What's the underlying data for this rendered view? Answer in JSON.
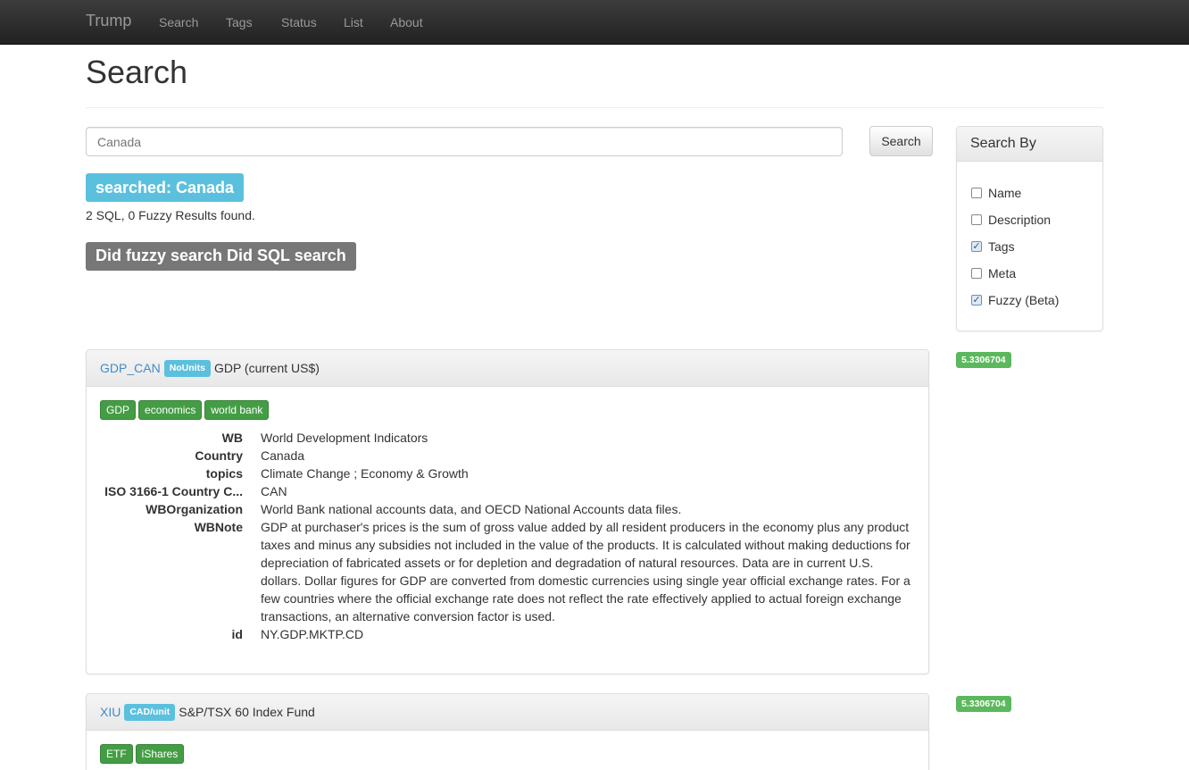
{
  "navbar": {
    "brand": "Trump",
    "items": [
      "Search",
      "Tags",
      "Status",
      "List",
      "About"
    ]
  },
  "page_title": "Search",
  "search": {
    "placeholder": "Canada",
    "button_label": "Search"
  },
  "searched_label": "searched: Canada",
  "results_count": "2 SQL, 0 Fuzzy Results found.",
  "did_label": "Did fuzzy search Did SQL search",
  "sidebar": {
    "heading": "Search By",
    "options": [
      {
        "label": "Name",
        "checked": false
      },
      {
        "label": "Description",
        "checked": false
      },
      {
        "label": "Tags",
        "checked": true
      },
      {
        "label": "Meta",
        "checked": false
      },
      {
        "label": "Fuzzy (Beta)",
        "checked": true
      }
    ]
  },
  "results": [
    {
      "name": "GDP_CAN",
      "unit": "NoUnits",
      "title": "GDP (current US$)",
      "score": "5.3306704",
      "tags": [
        "GDP",
        "economics",
        "world bank"
      ],
      "meta": [
        {
          "key": "WB",
          "value": "World Development Indicators"
        },
        {
          "key": "Country",
          "value": "Canada"
        },
        {
          "key": "topics",
          "value": "Climate Change ; Economy & Growth"
        },
        {
          "key": "ISO 3166-1 Country C...",
          "value": "CAN"
        },
        {
          "key": "WBOrganization",
          "value": "World Bank national accounts data, and OECD National Accounts data files."
        },
        {
          "key": "WBNote",
          "value": "GDP at purchaser's prices is the sum of gross value added by all resident producers in the economy plus any product taxes and minus any subsidies not included in the value of the products. It is calculated without making deductions for depreciation of fabricated assets or for depletion and degradation of natural resources. Data are in current U.S. dollars. Dollar figures for GDP are converted from domestic currencies using single year official exchange rates. For a few countries where the official exchange rate does not reflect the rate effectively applied to actual foreign exchange transactions, an alternative conversion factor is used."
        },
        {
          "key": "id",
          "value": "NY.GDP.MKTP.CD"
        }
      ]
    },
    {
      "name": "XIU",
      "unit": "CAD/unit",
      "title": "S&P/TSX 60 Index Fund",
      "score": "5.3306704",
      "tags": [
        "ETF",
        "iShares"
      ]
    }
  ]
}
